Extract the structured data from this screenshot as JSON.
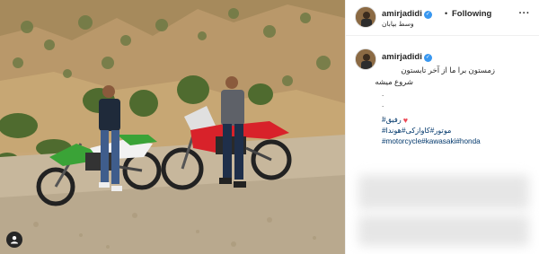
{
  "post": {
    "username": "amirjadidi",
    "follow_state": "Following",
    "separator": "•",
    "location": "وسط بیابان",
    "more": "···"
  },
  "caption": {
    "username": "amirjadidi",
    "line1": "زمستون برا ما از آخر تابستون",
    "line2": "شروع میشه",
    "dots": [
      ".",
      ".",
      "."
    ],
    "hashtags": {
      "rafiq": "#رفیق",
      "persian_line": "موتور#کاوازکی#هوندا#",
      "english_line": "#motorcycle#kawasaki#honda"
    }
  },
  "icons": {
    "verified": "verified-badge-icon",
    "heart": "heart-emoji-icon",
    "user_tag": "user-tag-icon",
    "more": "more-options-icon"
  },
  "colors": {
    "accent_link": "#00376b",
    "verified_blue": "#3897f0",
    "heart_red": "#ed4956"
  }
}
